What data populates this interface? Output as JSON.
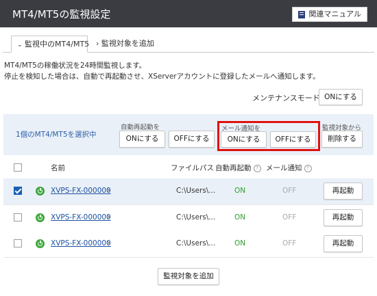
{
  "header": {
    "title": "MT4/MT5の監視設定",
    "manual_button": "関連マニュアル"
  },
  "tabs": [
    {
      "label": "監視中のMT4/MT5"
    },
    {
      "label": "監視対象を追加"
    }
  ],
  "description": {
    "line1": "MT4/MT5の稼働状況を24時間監視します。",
    "line2": "停止を検知した場合は、自動で再起動させ、XServerアカウントに登録したメールへ通知します。"
  },
  "maintenance": {
    "label": "メンテナンスモード",
    "button": "ONにする"
  },
  "bulk": {
    "selected_text": "1個のMT4/MT5を選択中",
    "auto_restart_label": "自動再起動を",
    "auto_on": "ONにする",
    "auto_off": "OFFにする",
    "mail_label": "メール通知を",
    "mail_on": "ONにする",
    "mail_off": "OFFにする",
    "remove_label": "監視対象から",
    "remove_button": "削除する"
  },
  "table": {
    "headers": {
      "name": "名前",
      "filepath": "ファイルパス",
      "auto_restart": "自動再起動",
      "mail": "メール通知"
    },
    "rows": [
      {
        "name": "XVPS-FX-000000",
        "path": "C:\\Users\\...",
        "auto_restart": "ON",
        "mail": "OFF",
        "action": "再起動",
        "checked": true
      },
      {
        "name": "XVPS-FX-000000",
        "path": "C:\\Users\\...",
        "auto_restart": "ON",
        "mail": "OFF",
        "action": "再起動",
        "checked": false
      },
      {
        "name": "XVPS-FX-000000",
        "path": "C:\\Users\\...",
        "auto_restart": "ON",
        "mail": "OFF",
        "action": "再起動",
        "checked": false
      }
    ]
  },
  "add_button": "監視対象を追加",
  "icons": {
    "manual": "book-icon",
    "help": "help-icon",
    "power": "power-icon",
    "chevron": "chevron-right-icon",
    "tab_chevron": "chevron-down-icon"
  },
  "colors": {
    "header_bg": "#3a3c42",
    "accent_blue": "#1a5fb4",
    "on_green": "#2fa02f",
    "highlight_red": "#e01010",
    "bulk_bg": "#eaf0f8"
  }
}
